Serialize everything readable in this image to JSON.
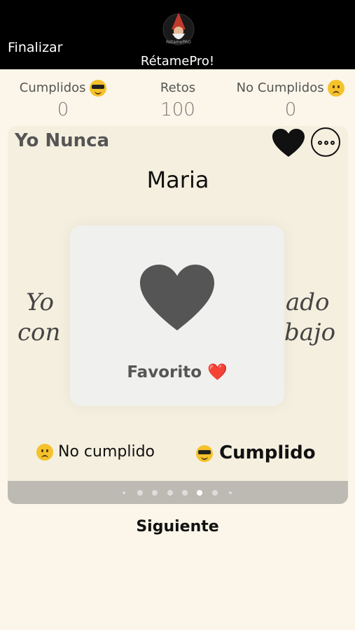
{
  "header": {
    "finalize_label": "Finalizar",
    "app_title": "RétamePro!",
    "logo_text": "RétamePRO"
  },
  "stats": {
    "completed_label": "Cumplidos",
    "completed_value": "0",
    "challenges_label": "Retos",
    "challenges_value": "100",
    "not_completed_label": "No Cumplidos",
    "not_completed_value": "0"
  },
  "card": {
    "title": "Yo Nunca",
    "player": "Maria",
    "challenge_line1_left": "Yo",
    "challenge_line1_right": "ado",
    "challenge_line2_left": "con",
    "challenge_line2_right": "bajo",
    "overlay_label": "Favorito ❤️"
  },
  "actions": {
    "not_completed_label": "No cumplido",
    "completed_label": "Cumplido",
    "next_label": "Siguiente"
  },
  "pager": {
    "count": 8,
    "active_index": 5
  },
  "colors": {
    "top_bar": "#000000",
    "background": "#fbf6e9",
    "card": "#f5efdf",
    "pager": "#bcbab2"
  },
  "icons": [
    "heart-icon",
    "more-icon",
    "sunglasses-emoji-icon",
    "frown-emoji-icon",
    "gnome-logo-icon"
  ]
}
